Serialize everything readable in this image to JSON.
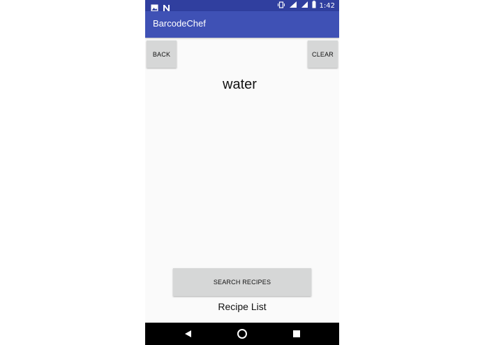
{
  "status_bar": {
    "left_icons": [
      "image-icon",
      "n-icon"
    ],
    "right_icons": [
      "vibrate-icon",
      "lte-signal-icon",
      "signal-icon",
      "battery-icon"
    ],
    "time": "1:42"
  },
  "app_bar": {
    "title": "BarcodeChef"
  },
  "buttons": {
    "back": "BACK",
    "clear": "CLEAR",
    "search": "SEARCH RECIPES"
  },
  "ingredient": "water",
  "recipe_list_label": "Recipe List",
  "nav_bar": {
    "icons": [
      "back-icon",
      "home-icon",
      "recents-icon"
    ]
  },
  "colors": {
    "status_bar": "#303f9f",
    "app_bar": "#3f51b5",
    "background": "#fafafa",
    "button": "#d6d7d7",
    "nav_bar": "#000000"
  }
}
